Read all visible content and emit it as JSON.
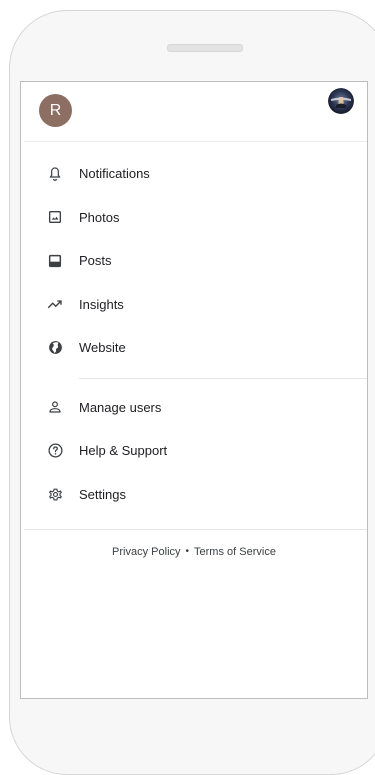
{
  "header": {
    "avatar_letter": "R",
    "avatar_color": "#8d6e63"
  },
  "menu_primary": [
    {
      "label": "Notifications",
      "icon": "bell-icon"
    },
    {
      "label": "Photos",
      "icon": "photo-icon"
    },
    {
      "label": "Posts",
      "icon": "posts-icon"
    },
    {
      "label": "Insights",
      "icon": "trending-up-icon"
    },
    {
      "label": "Website",
      "icon": "globe-icon"
    }
  ],
  "menu_secondary": [
    {
      "label": "Manage users",
      "icon": "person-icon"
    },
    {
      "label": "Help & Support",
      "icon": "help-icon"
    },
    {
      "label": "Settings",
      "icon": "gear-icon"
    }
  ],
  "footer": {
    "privacy": "Privacy Policy",
    "separator": "•",
    "terms": "Terms of Service"
  }
}
